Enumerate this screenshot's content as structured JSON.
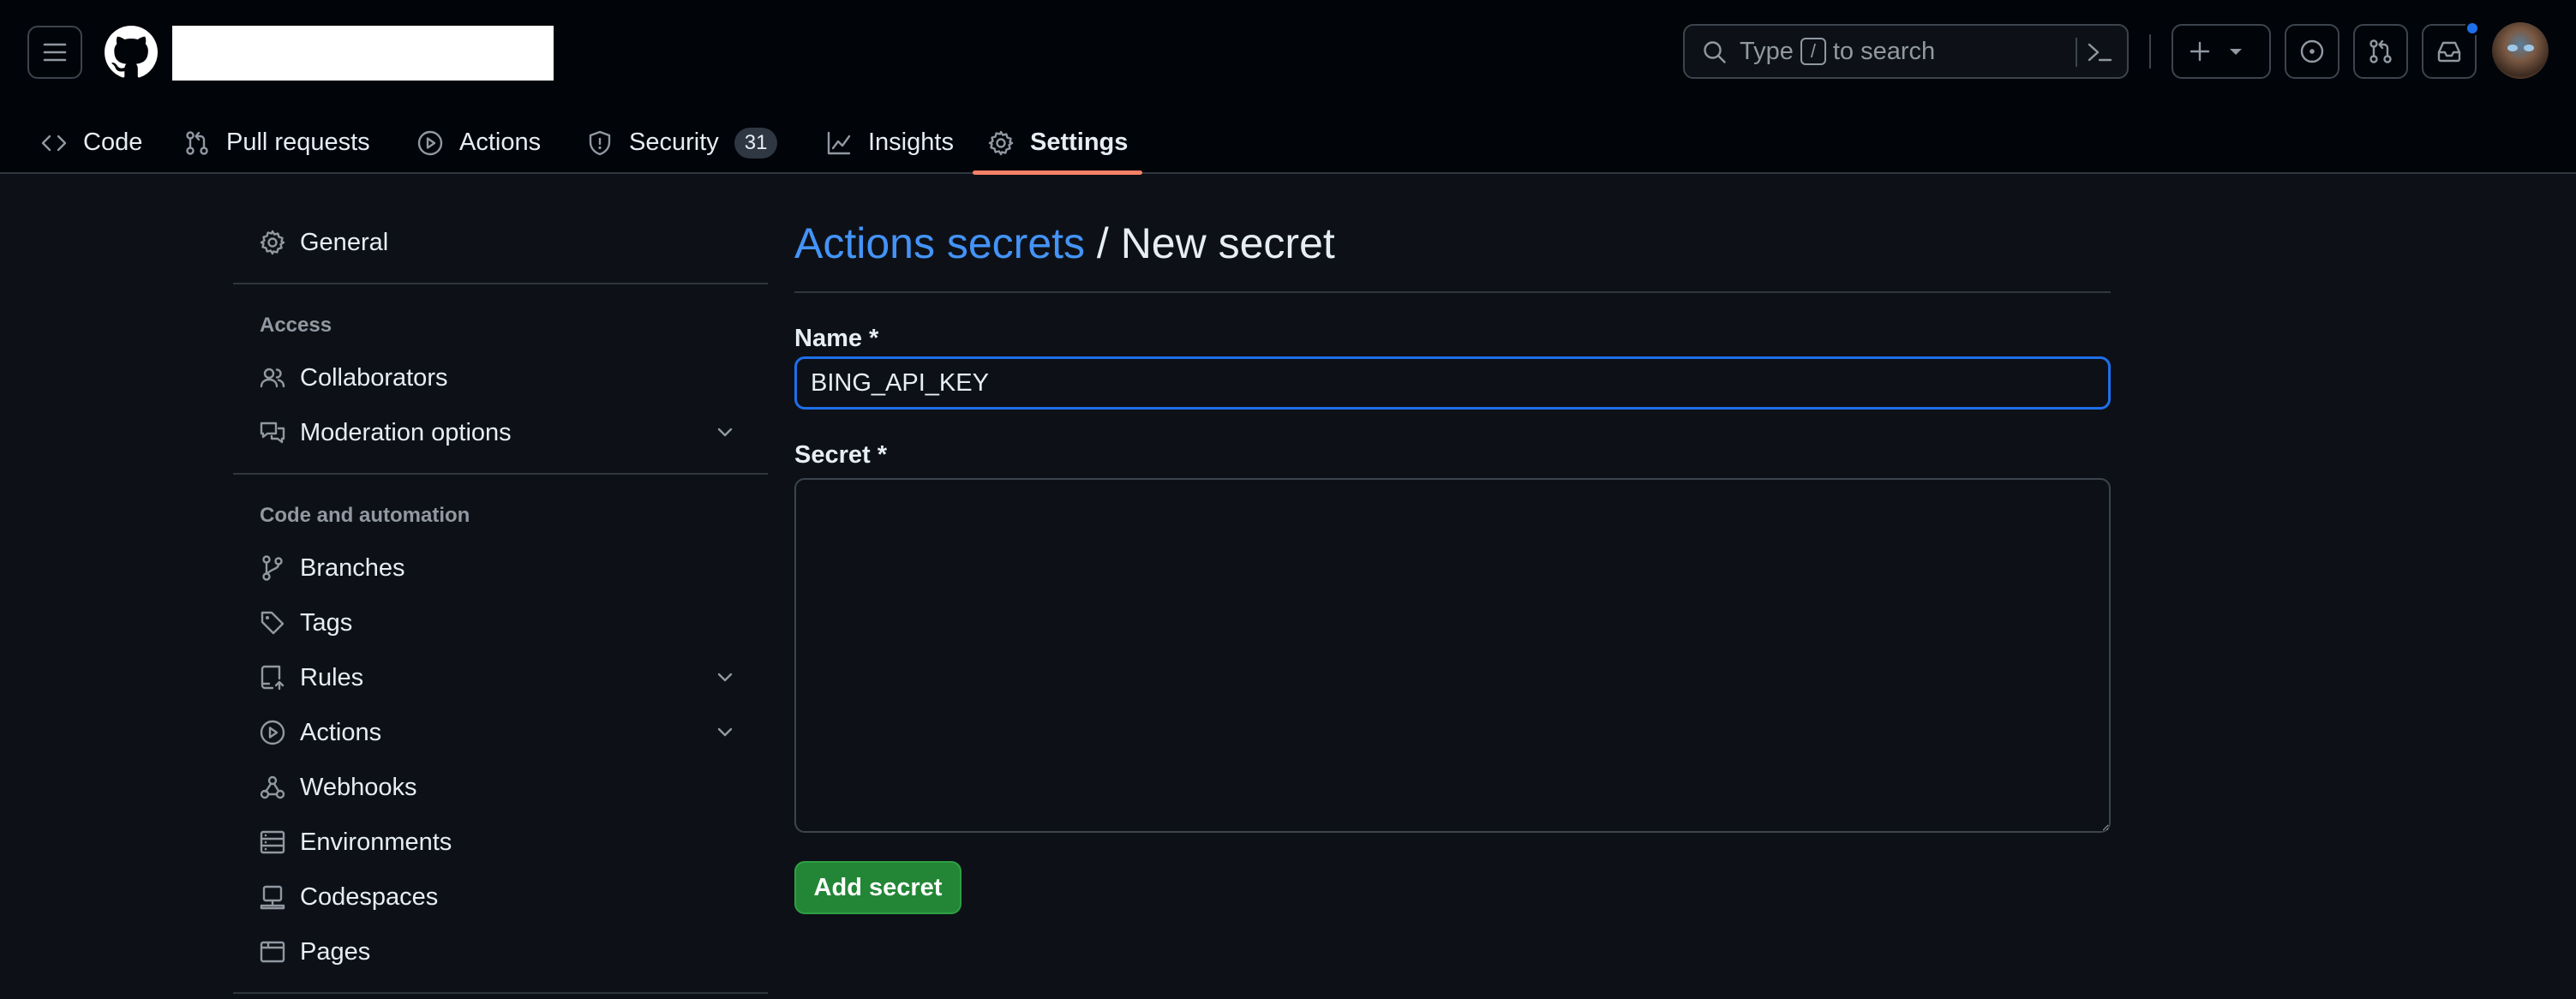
{
  "header": {
    "search_text_before": "Type",
    "search_key": "/",
    "search_text_after": "to search",
    "notification_color": "#1f6feb"
  },
  "repo_nav": {
    "tabs": [
      {
        "label": "Code",
        "icon": "code-icon"
      },
      {
        "label": "Pull requests",
        "icon": "git-pull-request-icon"
      },
      {
        "label": "Actions",
        "icon": "play-icon"
      },
      {
        "label": "Security",
        "icon": "shield-icon",
        "counter": "31"
      },
      {
        "label": "Insights",
        "icon": "graph-icon"
      },
      {
        "label": "Settings",
        "icon": "gear-icon",
        "selected": true
      }
    ],
    "selected_underline_color": "#f78166"
  },
  "sidebar": {
    "general": "General",
    "access_title": "Access",
    "collaborators": "Collaborators",
    "moderation": "Moderation options",
    "code_automation_title": "Code and automation",
    "branches": "Branches",
    "tags": "Tags",
    "rules": "Rules",
    "actions": "Actions",
    "webhooks": "Webhooks",
    "environments": "Environments",
    "codespaces": "Codespaces",
    "pages": "Pages"
  },
  "main": {
    "breadcrumb_link": "Actions secrets",
    "breadcrumb_sep": " / ",
    "page_title": "New secret",
    "name_label": "Name *",
    "name_value": "BING_API_KEY",
    "secret_label": "Secret *",
    "secret_value": "",
    "add_button": "Add secret",
    "accent_color": "#4493f8",
    "button_color": "#238636"
  }
}
